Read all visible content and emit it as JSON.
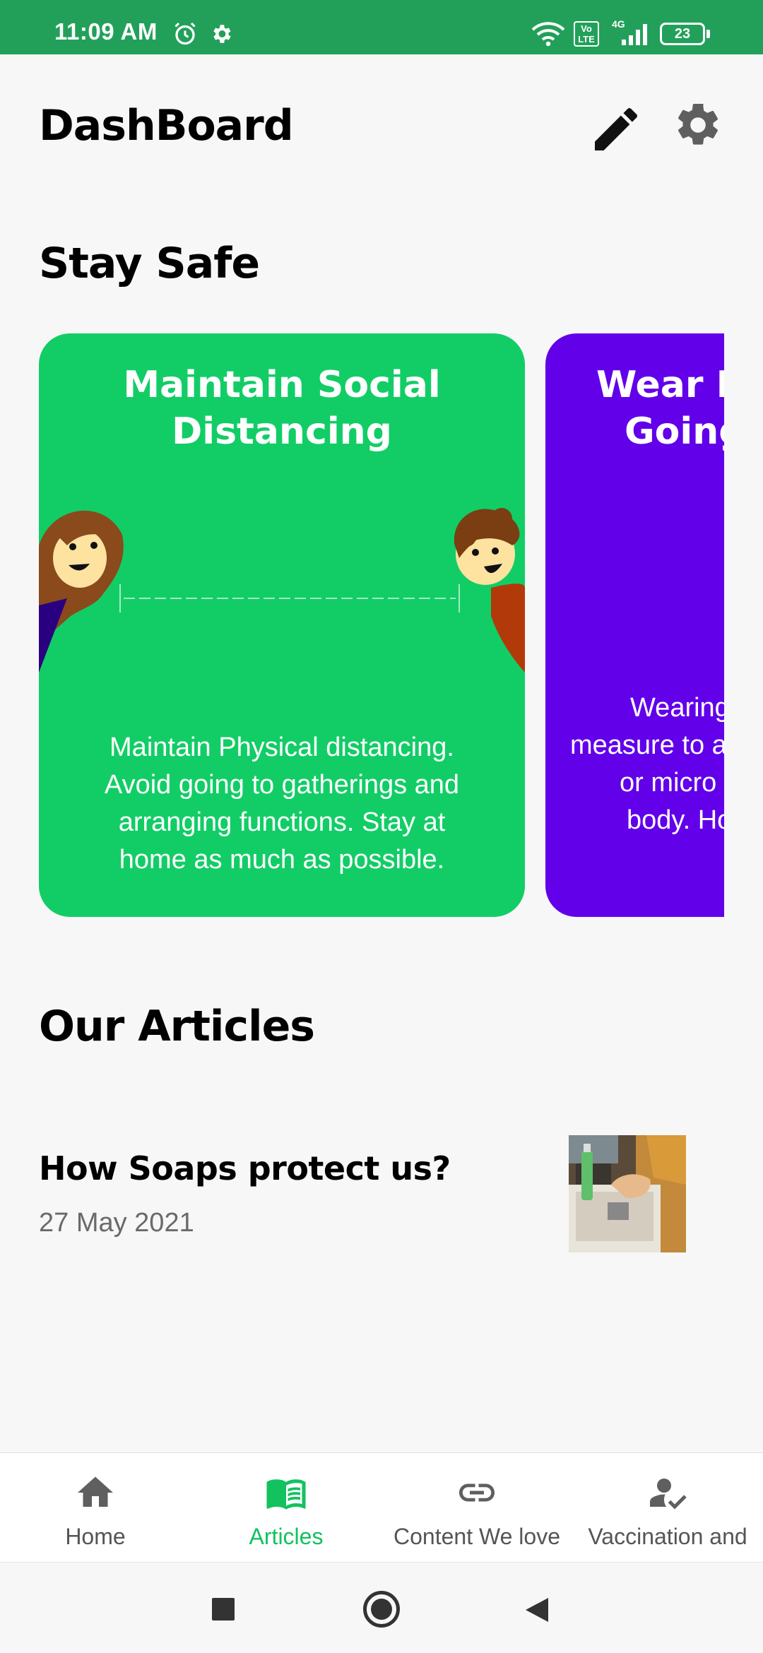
{
  "status_bar": {
    "time": "11:09 AM",
    "battery": "23",
    "network": "4G",
    "volte": "Vo LTE",
    "icons": [
      "alarm-icon",
      "gear-icon",
      "wifi-icon",
      "volte-icon",
      "signal-icon",
      "battery-icon"
    ],
    "color": "#22a05a"
  },
  "app_bar": {
    "title": "DashBoard",
    "edit_icon": "pencil-icon",
    "settings_icon": "gear-icon"
  },
  "stay_safe": {
    "title": "Stay Safe",
    "cards": [
      {
        "title_line1": "Maintain Social",
        "title_line2": "Distancing",
        "body": [
          "Maintain Physical distancing.",
          "Avoid going to gatherings and",
          "arranging functions. Stay at",
          "home as much as possible."
        ],
        "color": "#12cd66"
      },
      {
        "title_line1": "Wear Mask When",
        "title_line2": "Going Out",
        "body": [
          "Wearing a mask is a preventive",
          "measure to avoid virus droplets",
          "or micro particles entering the",
          "body. Hope you stay safe"
        ],
        "color": "#6200ea"
      }
    ]
  },
  "articles": {
    "title": "Our Articles",
    "items": [
      {
        "title": "How Soaps protect us?",
        "date": "27 May 2021"
      }
    ]
  },
  "bottom_nav": {
    "items": [
      {
        "label": "Home",
        "icon": "home-icon",
        "active": false
      },
      {
        "label": "Articles",
        "icon": "book-icon",
        "active": true
      },
      {
        "label": "Content We love",
        "icon": "link-icon",
        "active": false
      },
      {
        "label": "Vaccination and",
        "icon": "person-check-icon",
        "active": false
      }
    ],
    "active_color": "#12c25f"
  },
  "system_nav": {
    "icons": [
      "recents-square-icon",
      "home-circle-icon",
      "back-triangle-icon"
    ]
  }
}
